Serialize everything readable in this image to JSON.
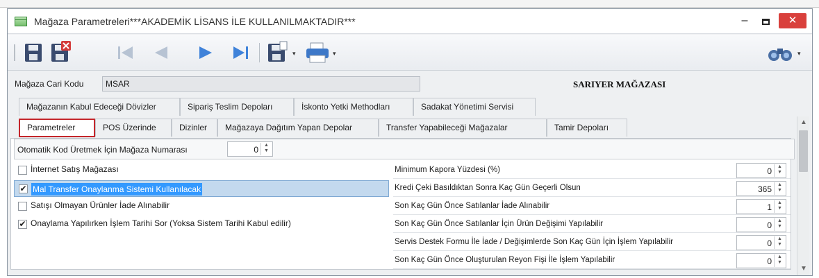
{
  "window": {
    "title": "Mağaza Parametreleri***AKADEMİK LİSANS İLE KULLANILMAKTADIR***",
    "controls": {
      "minimize": "–",
      "maximize": "",
      "close": "✕"
    }
  },
  "toolbar": {
    "buttons": [
      "save-icon",
      "delete-icon",
      "first-record-icon",
      "previous-record-icon",
      "next-record-icon",
      "last-record-icon",
      "export-icon",
      "print-icon",
      "binoculars-icon"
    ],
    "dropdown_arrow": "▾"
  },
  "header": {
    "cari_label": "Mağaza Cari Kodu",
    "cari_value": "MSAR",
    "store_name": "SARIYER MAĞAZASI"
  },
  "tabs_row1": [
    "Mağazanın Kabul Edeceği Dövizler",
    "Sipariş Teslim Depoları",
    "İskonto Yetki Methodları",
    "Sadakat Yönetimi Servisi"
  ],
  "tabs_row2": [
    "Parametreler",
    "POS Üzerinde",
    "Dizinler",
    "Mağazaya Dağıtım Yapan Depolar",
    "Transfer Yapabileceği Mağazalar",
    "Tamir Depoları"
  ],
  "active_tab": "Parametreler",
  "auto_code": {
    "label": "Otomatik Kod Üretmek İçin Mağaza Numarası",
    "value": "0"
  },
  "checkboxes": [
    {
      "label": "İnternet Satış Mağazası",
      "checked": false,
      "mark": ""
    },
    {
      "label": "Mal Transfer Onaylanma Sistemi Kullanılacak",
      "checked": true,
      "mark": "✔"
    },
    {
      "label": "Satışı Olmayan Ürünler İade Alınabilir",
      "checked": false,
      "mark": ""
    },
    {
      "label": "Onaylama Yapılırken İşlem Tarihi Sor (Yoksa Sistem Tarihi Kabul edilir)",
      "checked": true,
      "mark": "✔"
    }
  ],
  "params": [
    {
      "label": "Minimum Kapora Yüzdesi (%)",
      "value": "0"
    },
    {
      "label": "Kredi Çeki Basıldıktan Sonra Kaç Gün Geçerli Olsun",
      "value": "365"
    },
    {
      "label": "Son Kaç Gün Önce Satılanlar İade Alınabilir",
      "value": "1"
    },
    {
      "label": "Son Kaç Gün Önce Satılanlar İçin Ürün Değişimi Yapılabilir",
      "value": "0"
    },
    {
      "label": "Servis Destek Formu İle İade / Değişimlerde Son Kaç Gün İçin İşlem Yapılabilir",
      "value": "0"
    },
    {
      "label": "Son Kaç Gün Önce Oluşturulan Reyon Fişi İle İşlem Yapılabilir",
      "value": "0"
    }
  ],
  "spin_glyph": "▲\n▼",
  "scroll": {
    "up": "▲",
    "down": "▼"
  }
}
